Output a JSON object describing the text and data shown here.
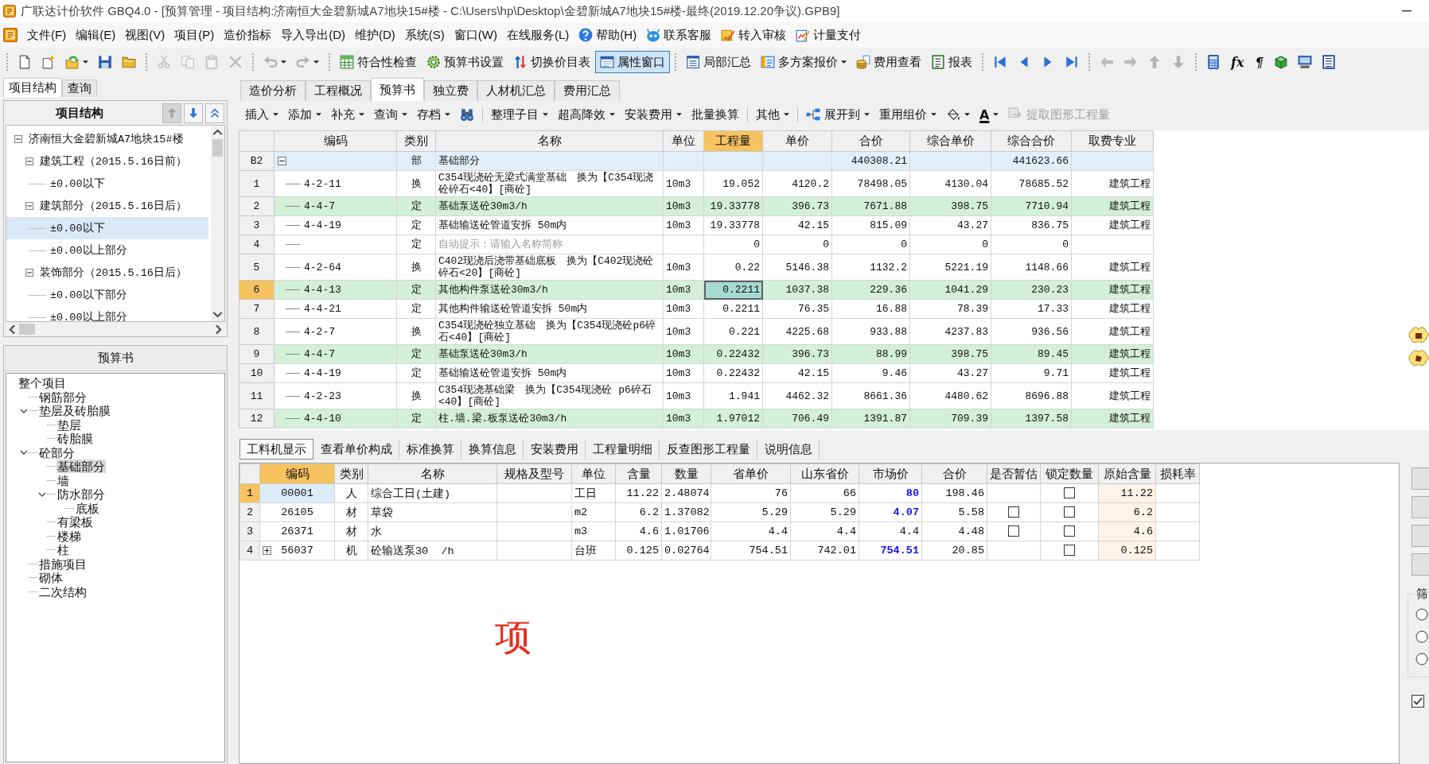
{
  "window": {
    "title": "广联达计价软件 GBQ4.0 - [预算管理 - 项目结构:济南恒大金碧新城A7地块15#楼 - C:\\Users\\hp\\Desktop\\金碧新城A7地块15#楼-最终(2019.12.20争议).GPB9]"
  },
  "menu": [
    {
      "label": "文件(F)",
      "kind": "text"
    },
    {
      "label": "编辑(E)",
      "kind": "text"
    },
    {
      "label": "视图(V)",
      "kind": "text"
    },
    {
      "label": "项目(P)",
      "kind": "text"
    },
    {
      "label": "造价指标",
      "kind": "text"
    },
    {
      "label": "导入导出(D)",
      "kind": "text"
    },
    {
      "label": "维护(D)",
      "kind": "text"
    },
    {
      "label": "系统(S)",
      "kind": "text"
    },
    {
      "label": "窗口(W)",
      "kind": "text"
    },
    {
      "label": "在线服务(L)",
      "kind": "text"
    },
    {
      "label": "帮助(H)",
      "kind": "icon"
    },
    {
      "label": "联系客服",
      "kind": "icon"
    },
    {
      "label": "转入审核",
      "kind": "icon"
    },
    {
      "label": "计量支付",
      "kind": "icon"
    }
  ],
  "toolbar": [
    {
      "items": [
        {
          "kind": "icon",
          "disabled": false
        },
        {
          "kind": "icon",
          "disabled": false
        },
        {
          "kind": "icon",
          "disabled": false,
          "dropdown": true
        },
        {
          "kind": "icon",
          "disabled": false
        },
        {
          "kind": "icon",
          "disabled": false
        }
      ]
    },
    {
      "items": [
        {
          "kind": "icon",
          "disabled": true
        },
        {
          "kind": "icon",
          "disabled": true
        },
        {
          "kind": "icon",
          "disabled": true
        },
        {
          "kind": "icon",
          "disabled": true
        }
      ]
    },
    {
      "items": [
        {
          "kind": "icon",
          "disabled": true,
          "dropdown": true
        },
        {
          "kind": "icon",
          "disabled": true,
          "dropdown": true
        }
      ]
    },
    {
      "items": [
        {
          "kind": "button",
          "label": "符合性检查",
          "disabled": false,
          "pressed": false
        },
        {
          "kind": "button",
          "label": "预算书设置",
          "disabled": false,
          "pressed": false
        },
        {
          "kind": "button",
          "label": "切换价目表",
          "disabled": false,
          "pressed": false
        },
        {
          "kind": "button",
          "label": "属性窗口",
          "disabled": false,
          "pressed": true
        }
      ]
    },
    {
      "items": [
        {
          "kind": "button",
          "label": "局部汇总",
          "disabled": false,
          "pressed": false
        },
        {
          "kind": "button",
          "label": "多方案报价",
          "disabled": false,
          "pressed": false,
          "dropdown": true
        },
        {
          "kind": "button",
          "label": "费用查看",
          "disabled": false,
          "pressed": false
        },
        {
          "kind": "button",
          "label": "报表",
          "disabled": false,
          "pressed": false
        }
      ]
    },
    {
      "items": [
        {
          "kind": "icon",
          "disabled": false
        },
        {
          "kind": "icon",
          "disabled": false
        },
        {
          "kind": "icon",
          "disabled": false
        },
        {
          "kind": "icon",
          "disabled": false
        }
      ]
    },
    {
      "items": [
        {
          "kind": "icon",
          "disabled": true
        },
        {
          "kind": "icon",
          "disabled": true
        },
        {
          "kind": "icon",
          "disabled": true
        },
        {
          "kind": "icon",
          "disabled": true
        }
      ]
    },
    {
      "items": [
        {
          "kind": "icon",
          "disabled": false
        },
        {
          "kind": "glyph",
          "label": "fx",
          "disabled": false
        },
        {
          "kind": "glyph",
          "label": "¶",
          "disabled": false
        },
        {
          "kind": "icon",
          "disabled": false
        },
        {
          "kind": "icon",
          "disabled": false
        },
        {
          "kind": "icon",
          "disabled": false
        }
      ]
    }
  ],
  "left_tabs": [
    {
      "label": "项目结构",
      "selected": true
    },
    {
      "label": "查询",
      "selected": false
    }
  ],
  "project_structure": {
    "title": "项目结构",
    "buttons": [
      {
        "disabled": true
      },
      {
        "disabled": false
      },
      {
        "disabled": false
      }
    ],
    "items": [
      {
        "label": "济南恒大金碧新城A7地块15#楼",
        "selected": false,
        "expanded": true,
        "children": [
          {
            "label": "建筑工程（2015.5.16日前）",
            "selected": false,
            "expanded": true,
            "children": [
              {
                "label": "±0.00以下",
                "selected": false
              }
            ]
          },
          {
            "label": "建筑部分（2015.5.16日后）",
            "selected": false,
            "expanded": true,
            "children": [
              {
                "label": "±0.00以下",
                "selected": true
              },
              {
                "label": "±0.00以上部分",
                "selected": false
              }
            ]
          },
          {
            "label": "装饰部分（2015.5.16日后）",
            "selected": false,
            "expanded": true,
            "children": [
              {
                "label": "±0.00以下部分",
                "selected": false
              },
              {
                "label": "±0.00以上部分",
                "selected": false
              }
            ]
          }
        ]
      }
    ]
  },
  "budget_tree": {
    "title": "预算书",
    "items": [
      {
        "label": "整个项目",
        "selected": false,
        "children": [
          {
            "label": "钢筋部分",
            "selected": false
          },
          {
            "label": "垫层及砖胎膜",
            "selected": false,
            "expanded": true,
            "children": [
              {
                "label": "垫层",
                "selected": false
              },
              {
                "label": "砖胎膜",
                "selected": false
              }
            ]
          },
          {
            "label": "砼部分",
            "selected": false,
            "expanded": true,
            "children": [
              {
                "label": "基础部分",
                "selected": true
              },
              {
                "label": "墙",
                "selected": false
              },
              {
                "label": "防水部分",
                "selected": false,
                "expanded": true,
                "children": [
                  {
                    "label": "底板",
                    "selected": false
                  }
                ]
              },
              {
                "label": "有梁板",
                "selected": false
              },
              {
                "label": "楼梯",
                "selected": false
              },
              {
                "label": "柱",
                "selected": false
              }
            ]
          },
          {
            "label": "措施项目",
            "selected": false
          },
          {
            "label": "砌体",
            "selected": false
          },
          {
            "label": "二次结构",
            "selected": false
          }
        ]
      }
    ]
  },
  "tabs": [
    {
      "label": "造价分析",
      "selected": false
    },
    {
      "label": "工程概况",
      "selected": false
    },
    {
      "label": "预算书",
      "selected": true
    },
    {
      "label": "独立费",
      "selected": false
    },
    {
      "label": "人材机汇总",
      "selected": false
    },
    {
      "label": "费用汇总",
      "selected": false
    }
  ],
  "subtoolbar": [
    {
      "items": [
        {
          "kind": "text",
          "label": "插入",
          "dropdown": true,
          "disabled": false
        },
        {
          "kind": "text",
          "label": "添加",
          "dropdown": true,
          "disabled": false
        },
        {
          "kind": "text",
          "label": "补充",
          "dropdown": true,
          "disabled": false
        },
        {
          "kind": "text",
          "label": "查询",
          "dropdown": true,
          "disabled": false
        },
        {
          "kind": "text",
          "label": "存档",
          "dropdown": true,
          "disabled": false
        },
        {
          "kind": "icon",
          "disabled": false
        }
      ]
    },
    {
      "items": [
        {
          "kind": "text",
          "label": "整理子目",
          "dropdown": true,
          "disabled": false
        },
        {
          "kind": "text",
          "label": "超高降效",
          "dropdown": true,
          "disabled": false
        },
        {
          "kind": "text",
          "label": "安装费用",
          "dropdown": true,
          "disabled": false
        },
        {
          "kind": "text",
          "label": "批量换算",
          "disabled": false
        }
      ]
    },
    {
      "items": [
        {
          "kind": "text",
          "label": "其他",
          "dropdown": true,
          "disabled": false
        }
      ]
    },
    {
      "items": [
        {
          "kind": "icon",
          "label": "展开到",
          "dropdown": true,
          "disabled": false
        },
        {
          "kind": "text",
          "label": "重用组价",
          "dropdown": true,
          "disabled": false
        },
        {
          "kind": "icon",
          "dropdown": true,
          "disabled": false
        },
        {
          "kind": "glyph",
          "label": "A",
          "dropdown": true,
          "disabled": false
        },
        {
          "kind": "icon",
          "label": "提取图形工程量",
          "disabled": true
        }
      ]
    }
  ],
  "budget_table": {
    "columns": [
      {
        "label": "编码",
        "selected": false
      },
      {
        "label": "类别",
        "selected": false
      },
      {
        "label": "名称",
        "selected": false
      },
      {
        "label": "单位",
        "selected": false
      },
      {
        "label": "工程量",
        "selected": true
      },
      {
        "label": "单价",
        "selected": false
      },
      {
        "label": "合价",
        "selected": false
      },
      {
        "label": "综合单价",
        "selected": false
      },
      {
        "label": "综合合价",
        "selected": false
      },
      {
        "label": "取费专业",
        "selected": false
      }
    ],
    "rows": [
      {
        "row_label": "B2",
        "kind": "section",
        "expanded": true,
        "type": "部",
        "name": "基础部分",
        "amount": "440308.21",
        "comp_amount": "441623.66",
        "selected": false,
        "highlighted": false
      },
      {
        "row_label": "1",
        "kind": "item",
        "code": "4-2-11",
        "type": "换",
        "name": "C354现浇砼无梁式满堂基础　换为【C354现浇砼碎石<40】[商砼]",
        "unit": "10m3",
        "quantity": "19.052",
        "unit_price": "4120.2",
        "amount": "78498.05",
        "comp_unit_price": "4130.04",
        "comp_amount": "78685.52",
        "fee": "建筑工程",
        "selected": false,
        "highlighted": false
      },
      {
        "row_label": "2",
        "kind": "item",
        "code": "4-4-7",
        "type": "定",
        "name": "基础泵送砼30m3/h",
        "unit": "10m3",
        "quantity": "19.33778",
        "unit_price": "396.73",
        "amount": "7671.88",
        "comp_unit_price": "398.75",
        "comp_amount": "7710.94",
        "fee": "建筑工程",
        "selected": false,
        "highlighted": true
      },
      {
        "row_label": "3",
        "kind": "item",
        "code": "4-4-19",
        "type": "定",
        "name": "基础输送砼管道安拆 50m内",
        "unit": "10m3",
        "quantity": "19.33778",
        "unit_price": "42.15",
        "amount": "815.09",
        "comp_unit_price": "43.27",
        "comp_amount": "836.75",
        "fee": "建筑工程",
        "selected": false,
        "highlighted": false
      },
      {
        "row_label": "4",
        "kind": "item",
        "type": "定",
        "name_placeholder": "自动提示：请输入名称简称",
        "quantity": "0",
        "unit_price": "0",
        "amount": "0",
        "comp_unit_price": "0",
        "comp_amount": "0",
        "selected": false,
        "highlighted": false
      },
      {
        "row_label": "5",
        "kind": "item",
        "code": "4-2-64",
        "type": "换",
        "name": "C402现浇后浇带基础底板　换为【C402现浇砼碎石<20】[商砼]",
        "unit": "10m3",
        "quantity": "0.22",
        "unit_price": "5146.38",
        "amount": "1132.2",
        "comp_unit_price": "5221.19",
        "comp_amount": "1148.66",
        "fee": "建筑工程",
        "selected": false,
        "highlighted": false
      },
      {
        "row_label": "6",
        "kind": "item",
        "code": "4-4-13",
        "type": "定",
        "name": "其他构件泵送砼30m3/h",
        "unit": "10m3",
        "quantity": "0.2211",
        "unit_price": "1037.38",
        "amount": "229.36",
        "comp_unit_price": "1041.29",
        "comp_amount": "230.23",
        "fee": "建筑工程",
        "selected": true,
        "highlighted": true
      },
      {
        "row_label": "7",
        "kind": "item",
        "code": "4-4-21",
        "type": "定",
        "name": "其他构件输送砼管道安拆 50m内",
        "unit": "10m3",
        "quantity": "0.2211",
        "unit_price": "76.35",
        "amount": "16.88",
        "comp_unit_price": "78.39",
        "comp_amount": "17.33",
        "fee": "建筑工程",
        "selected": false,
        "highlighted": false
      },
      {
        "row_label": "8",
        "kind": "item",
        "code": "4-2-7",
        "type": "换",
        "name": "C354现浇砼独立基础　换为【C354现浇砼p6碎石<40】[商砼]",
        "unit": "10m3",
        "quantity": "0.221",
        "unit_price": "4225.68",
        "amount": "933.88",
        "comp_unit_price": "4237.83",
        "comp_amount": "936.56",
        "fee": "建筑工程",
        "selected": false,
        "highlighted": false
      },
      {
        "row_label": "9",
        "kind": "item",
        "code": "4-4-7",
        "type": "定",
        "name": "基础泵送砼30m3/h",
        "unit": "10m3",
        "quantity": "0.22432",
        "unit_price": "396.73",
        "amount": "88.99",
        "comp_unit_price": "398.75",
        "comp_amount": "89.45",
        "fee": "建筑工程",
        "selected": false,
        "highlighted": true
      },
      {
        "row_label": "10",
        "kind": "item",
        "code": "4-4-19",
        "type": "定",
        "name": "基础输送砼管道安拆 50m内",
        "unit": "10m3",
        "quantity": "0.22432",
        "unit_price": "42.15",
        "amount": "9.46",
        "comp_unit_price": "43.27",
        "comp_amount": "9.71",
        "fee": "建筑工程",
        "selected": false,
        "highlighted": false
      },
      {
        "row_label": "11",
        "kind": "item",
        "code": "4-2-23",
        "type": "换",
        "name": "C354现浇基础梁　换为【C354现浇砼 p6碎石<40】[商砼]",
        "unit": "10m3",
        "quantity": "1.941",
        "unit_price": "4462.32",
        "amount": "8661.36",
        "comp_unit_price": "4480.62",
        "comp_amount": "8696.88",
        "fee": "建筑工程",
        "selected": false,
        "highlighted": false
      },
      {
        "row_label": "12",
        "kind": "item",
        "code": "4-4-10",
        "type": "定",
        "name": "柱.墙.梁.板泵送砼30m3/h",
        "unit": "10m3",
        "quantity": "1.97012",
        "unit_price": "706.49",
        "amount": "1391.87",
        "comp_unit_price": "709.39",
        "comp_amount": "1397.58",
        "fee": "建筑工程",
        "selected": false,
        "highlighted": true
      }
    ]
  },
  "bottom_tabs": [
    {
      "label": "工料机显示",
      "selected": true
    },
    {
      "label": "查看单价构成",
      "selected": false
    },
    {
      "label": "标准换算",
      "selected": false
    },
    {
      "label": "换算信息",
      "selected": false
    },
    {
      "label": "安装费用",
      "selected": false
    },
    {
      "label": "工程量明细",
      "selected": false
    },
    {
      "label": "反查图形工程量",
      "selected": false
    },
    {
      "label": "说明信息",
      "selected": false
    }
  ],
  "resource_table": {
    "columns": [
      {
        "label": "编码",
        "selected": true
      },
      {
        "label": "类别",
        "selected": false
      },
      {
        "label": "名称",
        "selected": false
      },
      {
        "label": "规格及型号",
        "selected": false
      },
      {
        "label": "单位",
        "selected": false
      },
      {
        "label": "含量",
        "selected": false
      },
      {
        "label": "数量",
        "selected": false
      },
      {
        "label": "省单价",
        "selected": false
      },
      {
        "label": "山东省价",
        "selected": false
      },
      {
        "label": "市场价",
        "selected": false
      },
      {
        "label": "合价",
        "selected": false
      },
      {
        "label": "是否暂估",
        "selected": false
      },
      {
        "label": "锁定数量",
        "selected": false
      },
      {
        "label": "原始含量",
        "selected": false
      },
      {
        "label": "损耗率",
        "selected": false
      }
    ],
    "rows": [
      {
        "row_label": "1",
        "selected": true,
        "code": "00001",
        "type": "人",
        "name": "综合工日(土建)",
        "unit": "工日",
        "content": "11.22",
        "quantity": "2.48074",
        "prov_price": "76",
        "sd_price": "66",
        "market_price": "80",
        "price_changed": true,
        "amount": "198.46",
        "locked": false,
        "original_content": "11.22"
      },
      {
        "row_label": "2",
        "selected": false,
        "code": "26105",
        "type": "材",
        "name": "草袋",
        "unit": "m2",
        "content": "6.2",
        "quantity": "1.37082",
        "prov_price": "5.29",
        "sd_price": "5.29",
        "market_price": "4.07",
        "price_changed": true,
        "amount": "5.58",
        "provisional": false,
        "locked": false,
        "original_content": "6.2"
      },
      {
        "row_label": "3",
        "selected": false,
        "code": "26371",
        "type": "材",
        "name": "水",
        "unit": "m3",
        "content": "4.6",
        "quantity": "1.01706",
        "prov_price": "4.4",
        "sd_price": "4.4",
        "market_price": "4.4",
        "price_changed": false,
        "amount": "4.48",
        "provisional": false,
        "locked": false,
        "original_content": "4.6"
      },
      {
        "row_label": "4",
        "selected": false,
        "expanded": false,
        "code": "56037",
        "type": "机",
        "name": "砼输送泵30  /h",
        "unit": "台班",
        "content": "0.125",
        "quantity": "0.02764",
        "prov_price": "754.51",
        "sd_price": "742.01",
        "market_price": "754.51",
        "price_changed": true,
        "amount": "20.85",
        "locked": false,
        "original_content": "0.125"
      }
    ]
  },
  "side_panel": {
    "group_label": "筛",
    "options": [
      {
        "selected": false
      },
      {
        "selected": false
      },
      {
        "selected": false
      }
    ],
    "checkbox": {
      "checked": true
    }
  },
  "floating_text": "项"
}
